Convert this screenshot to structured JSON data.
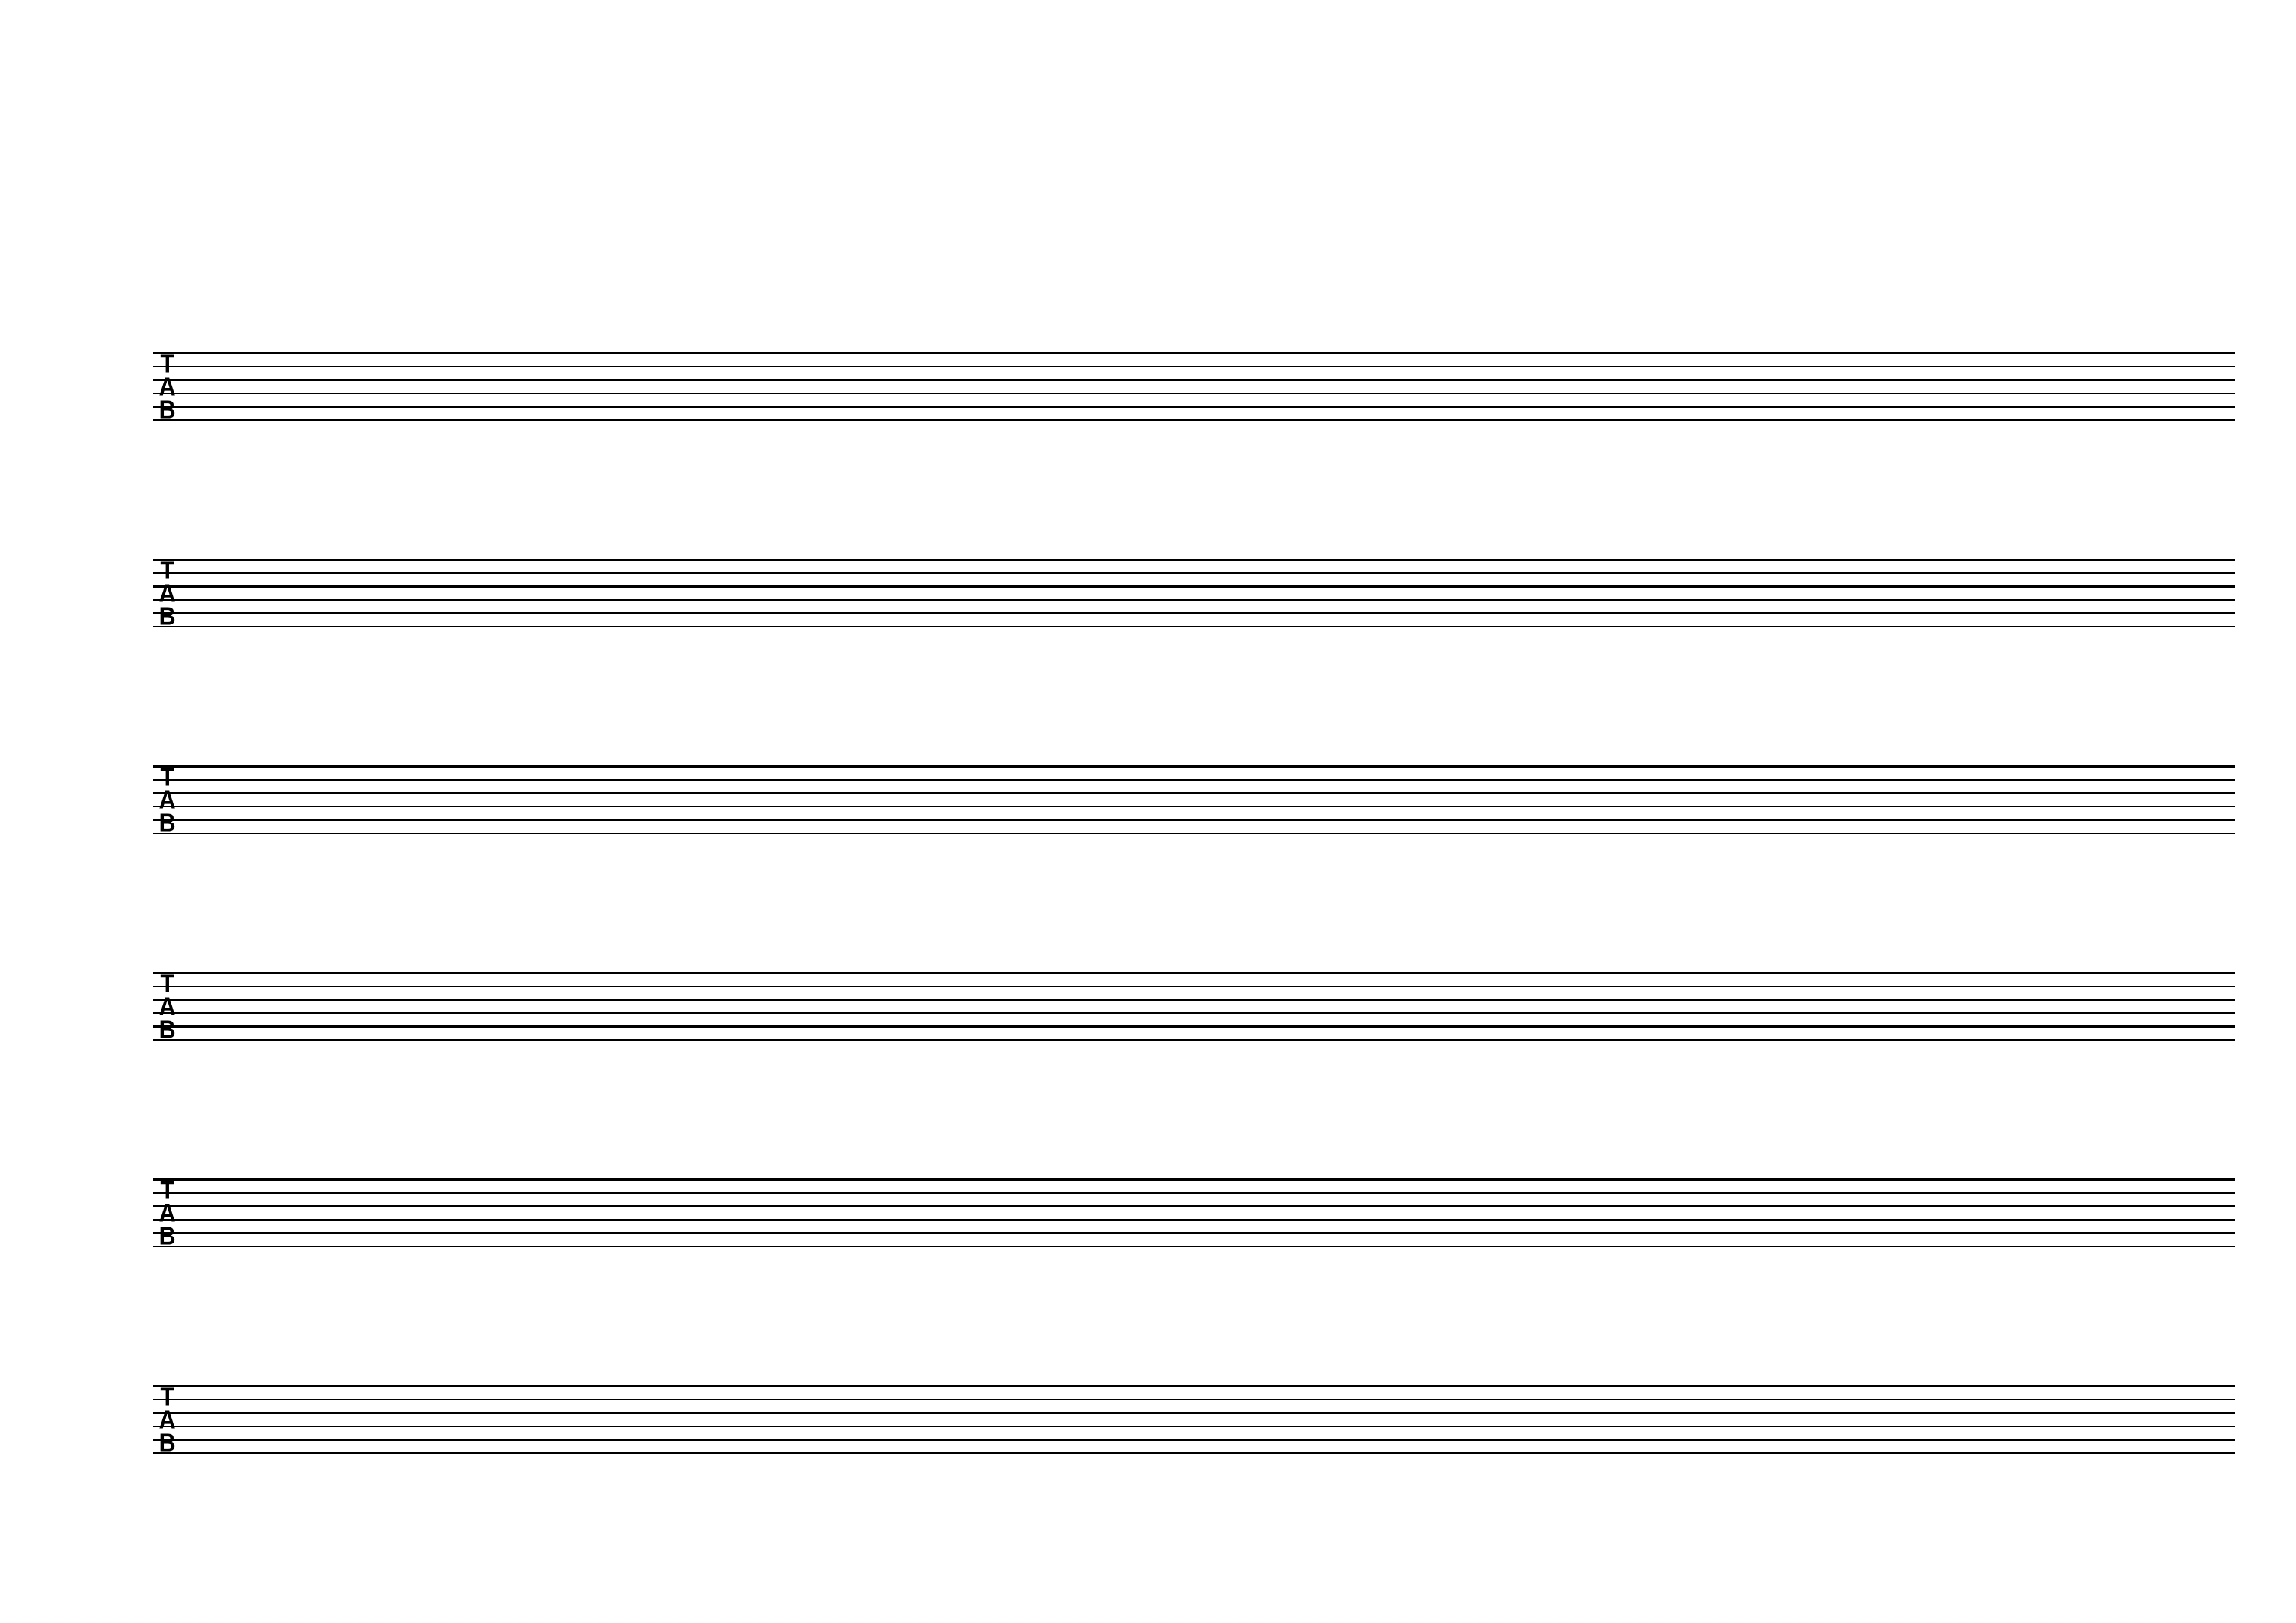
{
  "document": {
    "type": "blank-guitar-tablature-sheet",
    "orientation": "landscape"
  },
  "staff": {
    "count": 6,
    "strings_per_staff": 6,
    "clef": {
      "type": "TAB",
      "letters": [
        "T",
        "A",
        "B"
      ]
    }
  }
}
